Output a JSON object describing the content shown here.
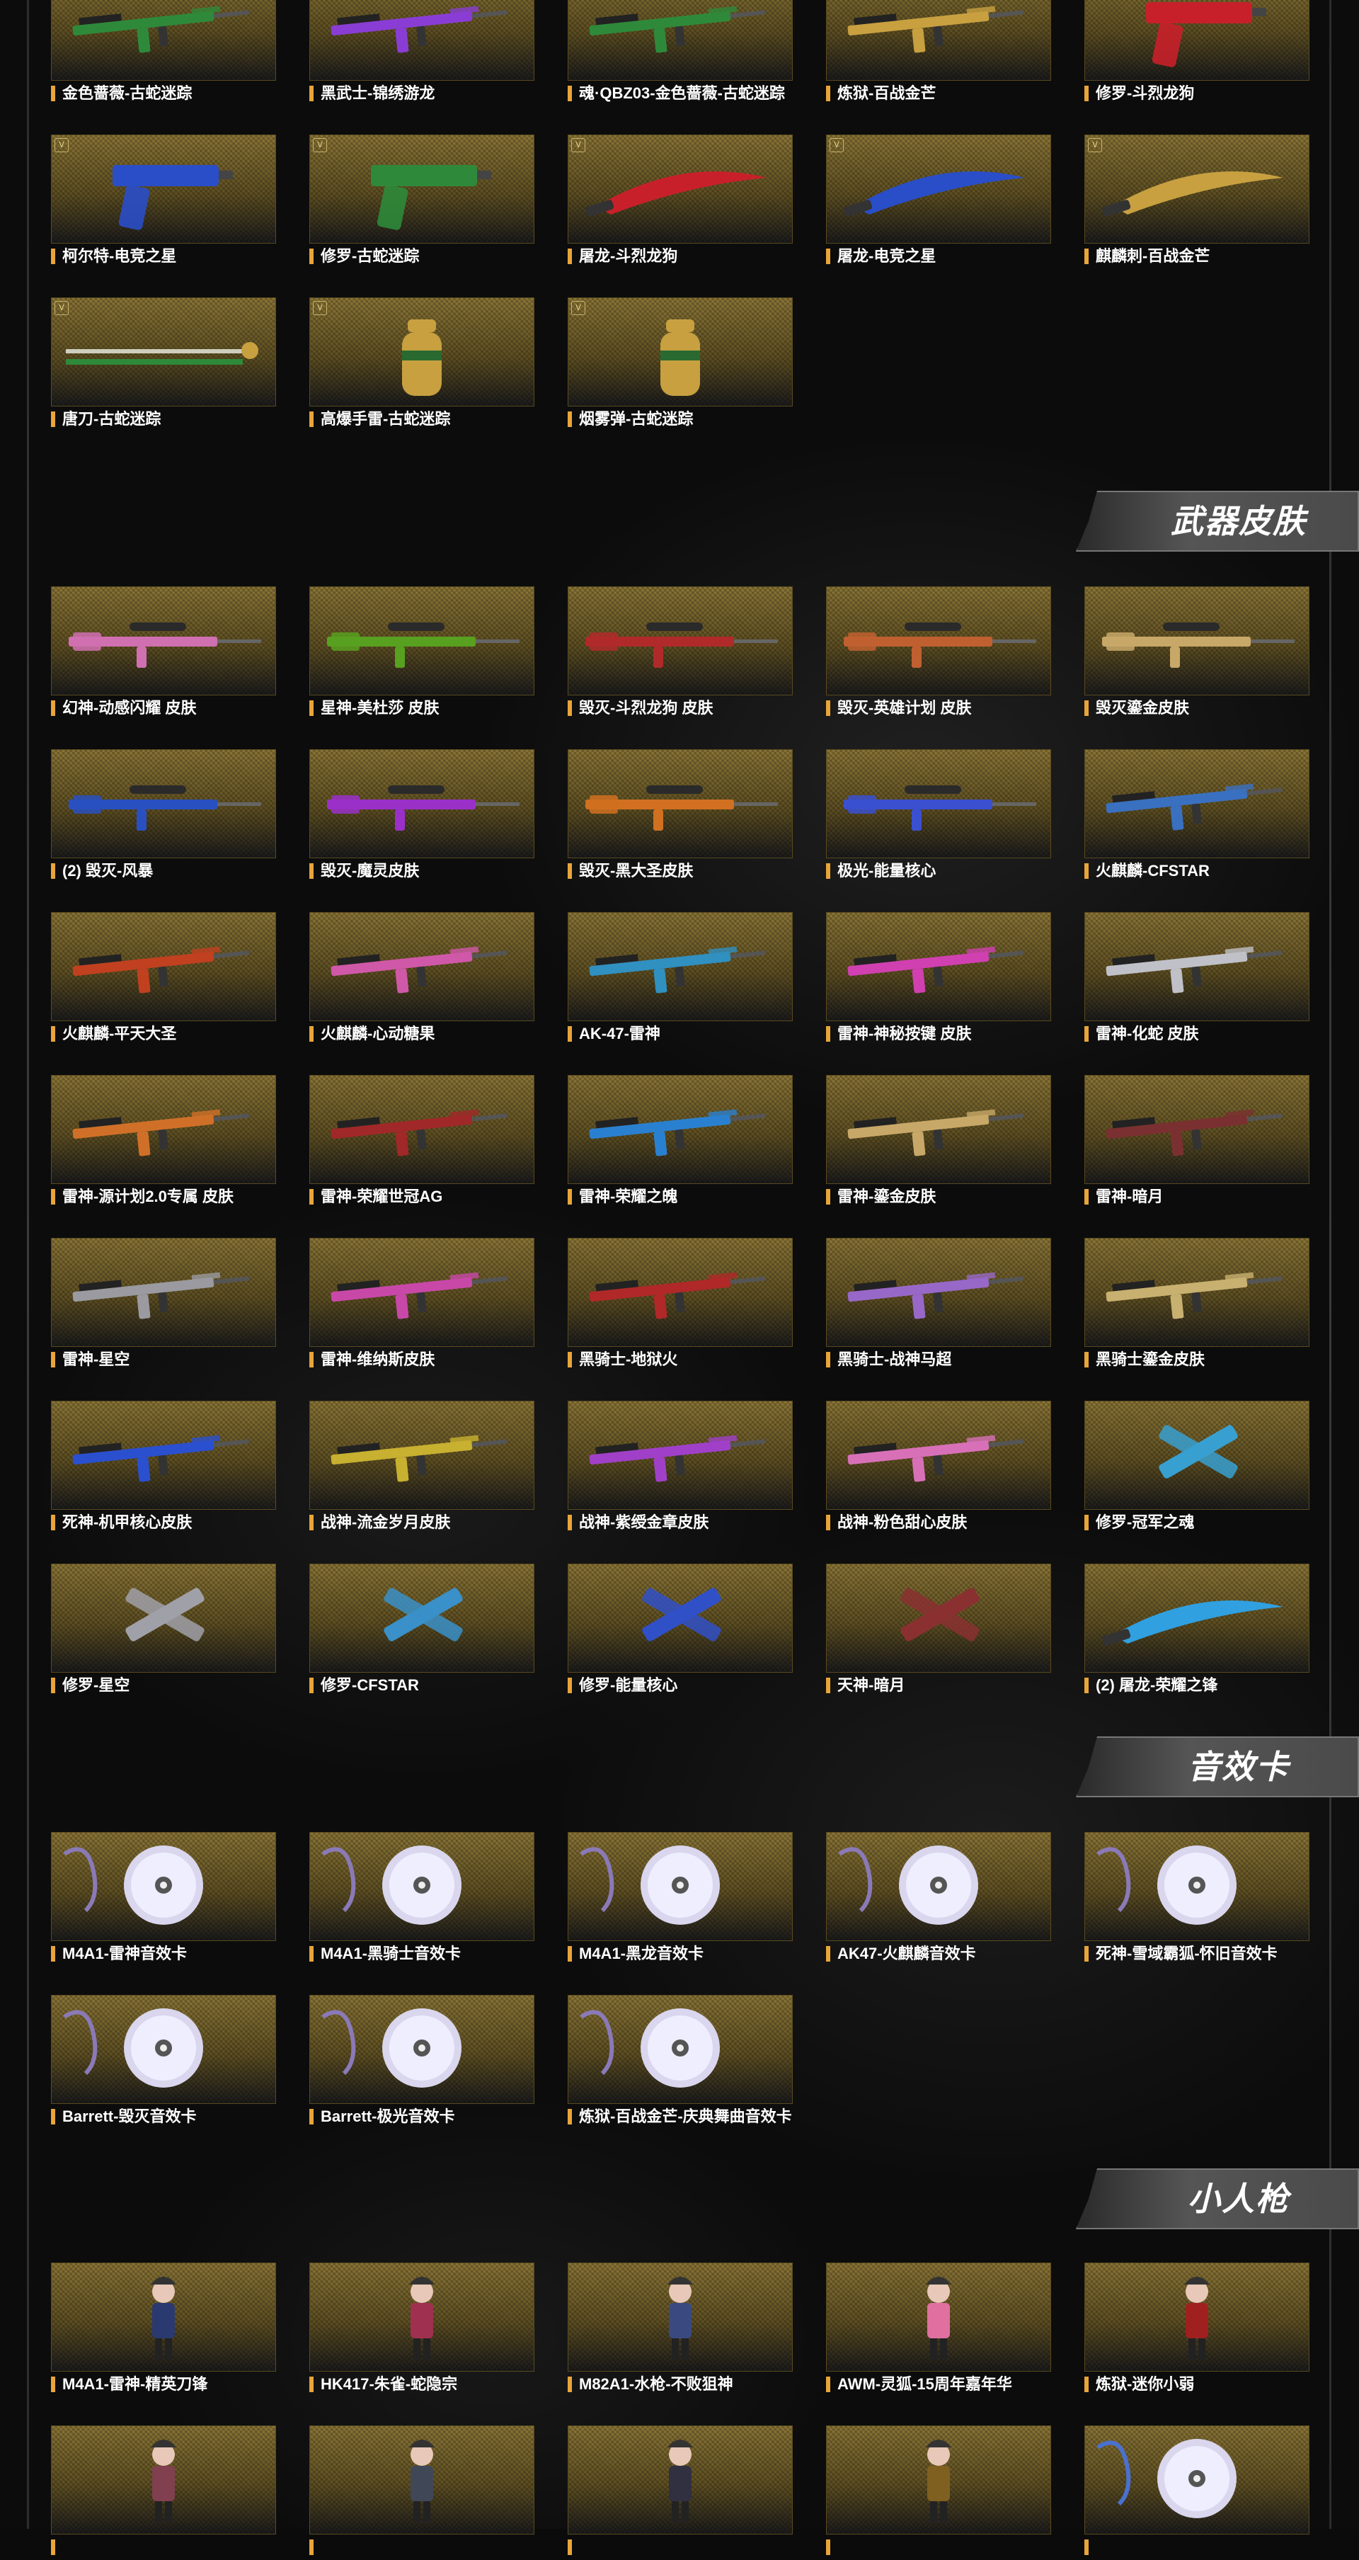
{
  "sections": [
    {
      "heading": "",
      "items": [
        {
          "label": "金色蔷薇-古蛇迷踪",
          "art": "rifle",
          "color": "#2e8a3a",
          "badge": "V"
        },
        {
          "label": "黑武士-锦绣游龙",
          "art": "rifle",
          "color": "#8a3dd4",
          "badge": "V"
        },
        {
          "label": "魂·QBZ03-金色蔷薇-古蛇迷踪",
          "art": "rifle",
          "color": "#2e8a3a",
          "badge": "V"
        },
        {
          "label": "炼狱-百战金芒",
          "art": "rifle",
          "color": "#c8a040",
          "badge": "V"
        },
        {
          "label": "修罗-斗烈龙狗",
          "art": "pistol",
          "color": "#c8202a",
          "badge": "V"
        },
        {
          "label": "柯尔特-电竞之星",
          "art": "pistol",
          "color": "#2a4ec8",
          "badge": "V"
        },
        {
          "label": "修罗-古蛇迷踪",
          "art": "pistol",
          "color": "#2e8a3a",
          "badge": "V"
        },
        {
          "label": "屠龙-斗烈龙狗",
          "art": "blade",
          "color": "#c8202a",
          "badge": "V"
        },
        {
          "label": "屠龙-电竞之星",
          "art": "blade",
          "color": "#2a4ec8",
          "badge": "V"
        },
        {
          "label": "麒麟刺-百战金芒",
          "art": "blade",
          "color": "#c8a040",
          "badge": "V"
        },
        {
          "label": "唐刀-古蛇迷踪",
          "art": "sword",
          "color": "#2e8a3a",
          "badge": "V"
        },
        {
          "label": "高爆手雷-古蛇迷踪",
          "art": "grenade",
          "color": "#c8a040",
          "badge": "V"
        },
        {
          "label": "烟雾弹-古蛇迷踪",
          "art": "grenade",
          "color": "#c8a040",
          "badge": "V"
        }
      ]
    },
    {
      "heading": "武器皮肤",
      "items": [
        {
          "label": "幻神-动感闪耀 皮肤",
          "art": "sniper",
          "color": "#d070b0",
          "badge": ""
        },
        {
          "label": "星神-美杜莎 皮肤",
          "art": "sniper",
          "color": "#58a020",
          "badge": ""
        },
        {
          "label": "毁灭-斗烈龙狗 皮肤",
          "art": "sniper",
          "color": "#b02a2a",
          "badge": ""
        },
        {
          "label": "毁灭-英雄计划 皮肤",
          "art": "sniper",
          "color": "#c06030",
          "badge": ""
        },
        {
          "label": "毁灭鎏金皮肤",
          "art": "sniper",
          "color": "#c8a868",
          "badge": ""
        },
        {
          "label": "(2) 毁灭-风暴",
          "art": "sniper",
          "color": "#2850c0",
          "badge": ""
        },
        {
          "label": "毁灭-魔灵皮肤",
          "art": "sniper",
          "color": "#9a30c8",
          "badge": ""
        },
        {
          "label": "毁灭-黑大圣皮肤",
          "art": "sniper",
          "color": "#d07020",
          "badge": ""
        },
        {
          "label": "极光-能量核心",
          "art": "sniper",
          "color": "#3a50d0",
          "badge": ""
        },
        {
          "label": "火麒麟-CFSTAR",
          "art": "rifle",
          "color": "#3a70c0",
          "badge": ""
        },
        {
          "label": "火麒麟-平天大圣",
          "art": "rifle",
          "color": "#c04020",
          "badge": ""
        },
        {
          "label": "火麒麟-心动糖果",
          "art": "rifle",
          "color": "#d058a8",
          "badge": ""
        },
        {
          "label": "AK-47-雷神",
          "art": "rifle",
          "color": "#3090c0",
          "badge": ""
        },
        {
          "label": "雷神-神秘按键 皮肤",
          "art": "rifle",
          "color": "#d040b0",
          "badge": ""
        },
        {
          "label": "雷神-化蛇 皮肤",
          "art": "rifle",
          "color": "#c0c0c8",
          "badge": ""
        },
        {
          "label": "雷神-源计划2.0专属 皮肤",
          "art": "rifle",
          "color": "#d07028",
          "badge": ""
        },
        {
          "label": "雷神-荣耀世冠AG",
          "art": "rifle",
          "color": "#a02828",
          "badge": ""
        },
        {
          "label": "雷神-荣耀之魄",
          "art": "rifle",
          "color": "#2a80d0",
          "badge": ""
        },
        {
          "label": "雷神-鎏金皮肤",
          "art": "rifle",
          "color": "#c8a868",
          "badge": ""
        },
        {
          "label": "雷神-暗月",
          "art": "rifle",
          "color": "#7a3030",
          "badge": ""
        },
        {
          "label": "雷神-星空",
          "art": "rifle",
          "color": "#9a9aa0",
          "badge": ""
        },
        {
          "label": "雷神-维纳斯皮肤",
          "art": "rifle",
          "color": "#c848a8",
          "badge": ""
        },
        {
          "label": "黑骑士-地狱火",
          "art": "rifle",
          "color": "#b02828",
          "badge": ""
        },
        {
          "label": "黑骑士-战神马超",
          "art": "rifle",
          "color": "#9868c8",
          "badge": ""
        },
        {
          "label": "黑骑士鎏金皮肤",
          "art": "rifle",
          "color": "#c8b070",
          "badge": ""
        },
        {
          "label": "死神-机甲核心皮肤",
          "art": "rifle",
          "color": "#2a50d0",
          "badge": ""
        },
        {
          "label": "战神-流金岁月皮肤",
          "art": "rifle",
          "color": "#c8b030",
          "badge": ""
        },
        {
          "label": "战神-紫绶金章皮肤",
          "art": "rifle",
          "color": "#a040c8",
          "badge": ""
        },
        {
          "label": "战神-粉色甜心皮肤",
          "art": "rifle",
          "color": "#d870b8",
          "badge": ""
        },
        {
          "label": "修罗-冠军之魂",
          "art": "dual",
          "color": "#38a0d0",
          "badge": ""
        },
        {
          "label": "修罗-星空",
          "art": "dual",
          "color": "#a0a0a8",
          "badge": ""
        },
        {
          "label": "修罗-CFSTAR",
          "art": "dual",
          "color": "#3a90c8",
          "badge": ""
        },
        {
          "label": "修罗-能量核心",
          "art": "dual",
          "color": "#3050c8",
          "badge": ""
        },
        {
          "label": "天神-暗月",
          "art": "dual",
          "color": "#8a3030",
          "badge": ""
        },
        {
          "label": "(2) 屠龙-荣耀之锋",
          "art": "blade",
          "color": "#30a0e0",
          "badge": ""
        }
      ]
    },
    {
      "heading": "音效卡",
      "items": [
        {
          "label": "M4A1-雷神音效卡",
          "art": "disc",
          "color": "#8a7ab8",
          "badge": ""
        },
        {
          "label": "M4A1-黑骑士音效卡",
          "art": "disc",
          "color": "#8a7ab8",
          "badge": ""
        },
        {
          "label": "M4A1-黑龙音效卡",
          "art": "disc",
          "color": "#8a7ab8",
          "badge": ""
        },
        {
          "label": "AK47-火麒麟音效卡",
          "art": "disc",
          "color": "#8a7ab8",
          "badge": ""
        },
        {
          "label": "死神-雪域霸狐-怀旧音效卡",
          "art": "disc",
          "color": "#8a7ab8",
          "badge": ""
        },
        {
          "label": "Barrett-毁灭音效卡",
          "art": "disc",
          "color": "#8a7ab8",
          "badge": ""
        },
        {
          "label": "Barrett-极光音效卡",
          "art": "disc",
          "color": "#8a7ab8",
          "badge": ""
        },
        {
          "label": "炼狱-百战金芒-庆典舞曲音效卡",
          "art": "disc",
          "color": "#8a7ab8",
          "badge": ""
        }
      ]
    },
    {
      "heading": "小人枪",
      "items": [
        {
          "label": "M4A1-雷神-精英刀锋",
          "art": "figure",
          "color": "#2a3a70",
          "badge": ""
        },
        {
          "label": "HK417-朱雀-蛇隐宗",
          "art": "figure",
          "color": "#a03050",
          "badge": ""
        },
        {
          "label": "M82A1-水枪-不败狙神",
          "art": "figure",
          "color": "#3a4a80",
          "badge": ""
        },
        {
          "label": "AWM-灵狐-15周年嘉年华",
          "art": "figure",
          "color": "#e070a0",
          "badge": ""
        },
        {
          "label": "炼狱-迷你小弱",
          "art": "figure",
          "color": "#a02020",
          "badge": ""
        },
        {
          "label": "",
          "art": "figure",
          "color": "#804050",
          "badge": ""
        },
        {
          "label": "",
          "art": "figure",
          "color": "#404858",
          "badge": ""
        },
        {
          "label": "",
          "art": "figure",
          "color": "#303040",
          "badge": ""
        },
        {
          "label": "",
          "art": "figure",
          "color": "#806020",
          "badge": ""
        },
        {
          "label": "",
          "art": "disc",
          "color": "#4a70d0",
          "badge": ""
        }
      ]
    }
  ]
}
